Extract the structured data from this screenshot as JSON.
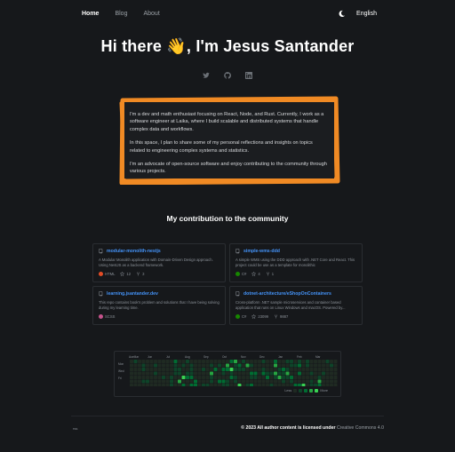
{
  "nav": {
    "items": [
      {
        "label": "Home",
        "active": true
      },
      {
        "label": "Blog",
        "active": false
      },
      {
        "label": "About",
        "active": false
      }
    ],
    "theme_icon": "moon-icon",
    "language": "English"
  },
  "hero": {
    "title": "Hi there 👋, I'm Jesus Santander"
  },
  "socials": [
    "twitter-icon",
    "github-icon",
    "linkedin-icon"
  ],
  "bio": {
    "paragraphs": [
      "I'm a dev and math enthusiast focusing on React, Node, and Rust. Currently, I work as a software engineer at Laika, where I build scalable and distributed systems that handle complex data and workflows.",
      "In this space, I plan to share some of my personal reflections and insights on topics related to engineering complex systems and statistics.",
      "I'm an advocate of open-source software and enjoy contributing to the community through various projects."
    ],
    "border_color": "#f08a24"
  },
  "contributions": {
    "title": "My contribution to the community",
    "repos": [
      {
        "name": "modular-monolith-nestjs",
        "description": "A Modular Monolith application with Domain-Driven Design approach. Using NestJS as a backend framework.",
        "language": "HTML",
        "language_color": "#e34c26",
        "stars": "12",
        "forks": "3"
      },
      {
        "name": "simple-wms-ddd",
        "description": "A simple WMS using the DDD approach with .NET Core and React. This project could be use as a template for monolithic",
        "language": "C#",
        "language_color": "#178600",
        "stars": "4",
        "forks": "1"
      },
      {
        "name": "learning.jsantander.dev",
        "description": "This repo contains book's problem and solutions that I have being solving during my learning time.",
        "language": "SCSS",
        "language_color": "#c6538c",
        "stars": "",
        "forks": ""
      },
      {
        "name": "dotnet-architecture/eShopOnContainers",
        "description": "Cross-platform .NET sample microservices and container based application that runs on Linux Windows and macOS. Powered by...",
        "language": "C#",
        "language_color": "#178600",
        "stars": "23099",
        "forks": "9887"
      }
    ]
  },
  "calendar": {
    "months": [
      "AueMar",
      "Jun",
      "Jul",
      "Aug",
      "Sep",
      "Oct",
      "Nov",
      "Dec",
      "Jan",
      "Feb",
      "Mar"
    ],
    "days": [
      "Mon",
      "Wed",
      "Fri"
    ],
    "legend_less": "Less",
    "legend_more": "More",
    "levels": [
      "#1f2a22",
      "#0e4429",
      "#006d32",
      "#26a641",
      "#39d353"
    ]
  },
  "footer": {
    "rss": "rss",
    "text_bold": "© 2023 All author content is licensed under",
    "license": "Creative Commons 4.0"
  }
}
